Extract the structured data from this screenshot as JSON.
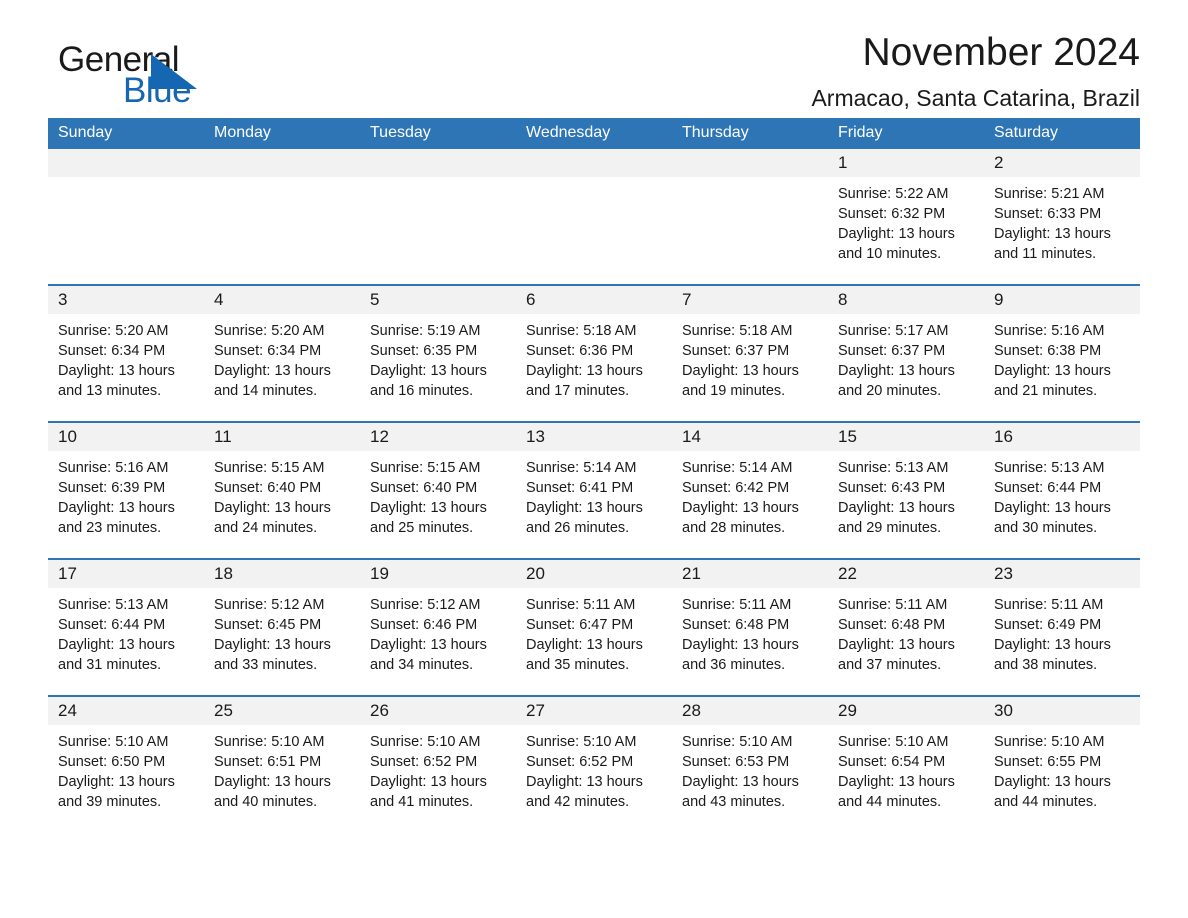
{
  "brand": {
    "name_part1": "General",
    "name_part2": "Blue",
    "triangle_color": "#1567b2"
  },
  "header": {
    "month_title": "November 2024",
    "location": "Armacao, Santa Catarina, Brazil"
  },
  "theme": {
    "header_blue": "#2e75b6",
    "daynum_gray": "#f2f2f2",
    "text": "#1a1a1a"
  },
  "weekdays": [
    "Sunday",
    "Monday",
    "Tuesday",
    "Wednesday",
    "Thursday",
    "Friday",
    "Saturday"
  ],
  "weeks": [
    [
      {
        "day": "",
        "lines": []
      },
      {
        "day": "",
        "lines": []
      },
      {
        "day": "",
        "lines": []
      },
      {
        "day": "",
        "lines": []
      },
      {
        "day": "",
        "lines": []
      },
      {
        "day": "1",
        "lines": [
          "Sunrise: 5:22 AM",
          "Sunset: 6:32 PM",
          "Daylight: 13 hours",
          "and 10 minutes."
        ]
      },
      {
        "day": "2",
        "lines": [
          "Sunrise: 5:21 AM",
          "Sunset: 6:33 PM",
          "Daylight: 13 hours",
          "and 11 minutes."
        ]
      }
    ],
    [
      {
        "day": "3",
        "lines": [
          "Sunrise: 5:20 AM",
          "Sunset: 6:34 PM",
          "Daylight: 13 hours",
          "and 13 minutes."
        ]
      },
      {
        "day": "4",
        "lines": [
          "Sunrise: 5:20 AM",
          "Sunset: 6:34 PM",
          "Daylight: 13 hours",
          "and 14 minutes."
        ]
      },
      {
        "day": "5",
        "lines": [
          "Sunrise: 5:19 AM",
          "Sunset: 6:35 PM",
          "Daylight: 13 hours",
          "and 16 minutes."
        ]
      },
      {
        "day": "6",
        "lines": [
          "Sunrise: 5:18 AM",
          "Sunset: 6:36 PM",
          "Daylight: 13 hours",
          "and 17 minutes."
        ]
      },
      {
        "day": "7",
        "lines": [
          "Sunrise: 5:18 AM",
          "Sunset: 6:37 PM",
          "Daylight: 13 hours",
          "and 19 minutes."
        ]
      },
      {
        "day": "8",
        "lines": [
          "Sunrise: 5:17 AM",
          "Sunset: 6:37 PM",
          "Daylight: 13 hours",
          "and 20 minutes."
        ]
      },
      {
        "day": "9",
        "lines": [
          "Sunrise: 5:16 AM",
          "Sunset: 6:38 PM",
          "Daylight: 13 hours",
          "and 21 minutes."
        ]
      }
    ],
    [
      {
        "day": "10",
        "lines": [
          "Sunrise: 5:16 AM",
          "Sunset: 6:39 PM",
          "Daylight: 13 hours",
          "and 23 minutes."
        ]
      },
      {
        "day": "11",
        "lines": [
          "Sunrise: 5:15 AM",
          "Sunset: 6:40 PM",
          "Daylight: 13 hours",
          "and 24 minutes."
        ]
      },
      {
        "day": "12",
        "lines": [
          "Sunrise: 5:15 AM",
          "Sunset: 6:40 PM",
          "Daylight: 13 hours",
          "and 25 minutes."
        ]
      },
      {
        "day": "13",
        "lines": [
          "Sunrise: 5:14 AM",
          "Sunset: 6:41 PM",
          "Daylight: 13 hours",
          "and 26 minutes."
        ]
      },
      {
        "day": "14",
        "lines": [
          "Sunrise: 5:14 AM",
          "Sunset: 6:42 PM",
          "Daylight: 13 hours",
          "and 28 minutes."
        ]
      },
      {
        "day": "15",
        "lines": [
          "Sunrise: 5:13 AM",
          "Sunset: 6:43 PM",
          "Daylight: 13 hours",
          "and 29 minutes."
        ]
      },
      {
        "day": "16",
        "lines": [
          "Sunrise: 5:13 AM",
          "Sunset: 6:44 PM",
          "Daylight: 13 hours",
          "and 30 minutes."
        ]
      }
    ],
    [
      {
        "day": "17",
        "lines": [
          "Sunrise: 5:13 AM",
          "Sunset: 6:44 PM",
          "Daylight: 13 hours",
          "and 31 minutes."
        ]
      },
      {
        "day": "18",
        "lines": [
          "Sunrise: 5:12 AM",
          "Sunset: 6:45 PM",
          "Daylight: 13 hours",
          "and 33 minutes."
        ]
      },
      {
        "day": "19",
        "lines": [
          "Sunrise: 5:12 AM",
          "Sunset: 6:46 PM",
          "Daylight: 13 hours",
          "and 34 minutes."
        ]
      },
      {
        "day": "20",
        "lines": [
          "Sunrise: 5:11 AM",
          "Sunset: 6:47 PM",
          "Daylight: 13 hours",
          "and 35 minutes."
        ]
      },
      {
        "day": "21",
        "lines": [
          "Sunrise: 5:11 AM",
          "Sunset: 6:48 PM",
          "Daylight: 13 hours",
          "and 36 minutes."
        ]
      },
      {
        "day": "22",
        "lines": [
          "Sunrise: 5:11 AM",
          "Sunset: 6:48 PM",
          "Daylight: 13 hours",
          "and 37 minutes."
        ]
      },
      {
        "day": "23",
        "lines": [
          "Sunrise: 5:11 AM",
          "Sunset: 6:49 PM",
          "Daylight: 13 hours",
          "and 38 minutes."
        ]
      }
    ],
    [
      {
        "day": "24",
        "lines": [
          "Sunrise: 5:10 AM",
          "Sunset: 6:50 PM",
          "Daylight: 13 hours",
          "and 39 minutes."
        ]
      },
      {
        "day": "25",
        "lines": [
          "Sunrise: 5:10 AM",
          "Sunset: 6:51 PM",
          "Daylight: 13 hours",
          "and 40 minutes."
        ]
      },
      {
        "day": "26",
        "lines": [
          "Sunrise: 5:10 AM",
          "Sunset: 6:52 PM",
          "Daylight: 13 hours",
          "and 41 minutes."
        ]
      },
      {
        "day": "27",
        "lines": [
          "Sunrise: 5:10 AM",
          "Sunset: 6:52 PM",
          "Daylight: 13 hours",
          "and 42 minutes."
        ]
      },
      {
        "day": "28",
        "lines": [
          "Sunrise: 5:10 AM",
          "Sunset: 6:53 PM",
          "Daylight: 13 hours",
          "and 43 minutes."
        ]
      },
      {
        "day": "29",
        "lines": [
          "Sunrise: 5:10 AM",
          "Sunset: 6:54 PM",
          "Daylight: 13 hours",
          "and 44 minutes."
        ]
      },
      {
        "day": "30",
        "lines": [
          "Sunrise: 5:10 AM",
          "Sunset: 6:55 PM",
          "Daylight: 13 hours",
          "and 44 minutes."
        ]
      }
    ]
  ]
}
